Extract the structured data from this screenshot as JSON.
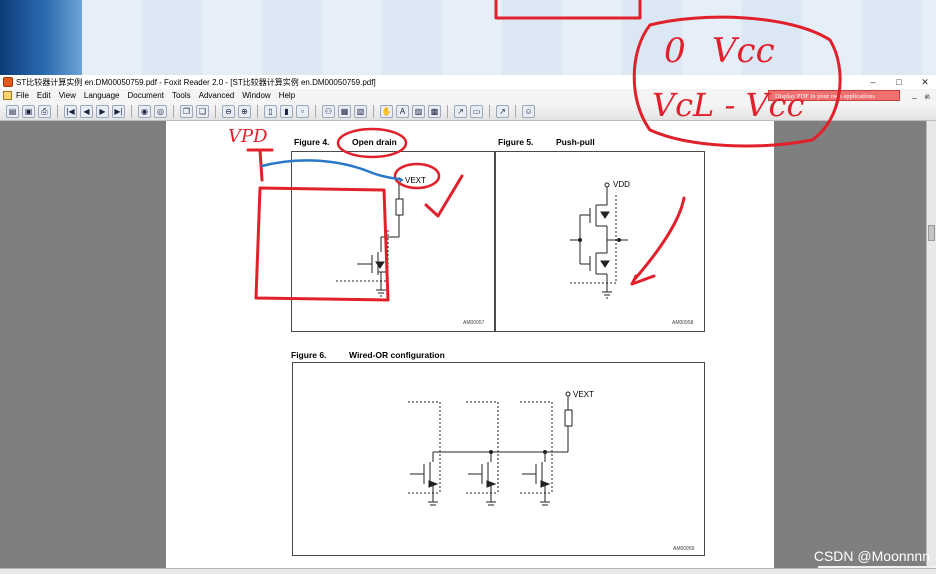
{
  "window": {
    "title": "ST比较器计算实例 en.DM00050759.pdf - Foxit Reader 2.0 - [ST比较器计算实例 en.DM00050759.pdf]",
    "minimize": "–",
    "maximize": "□",
    "close": "✕"
  },
  "menu": {
    "items": [
      "File",
      "Edit",
      "View",
      "Language",
      "Document",
      "Tools",
      "Advanced",
      "Window",
      "Help"
    ],
    "mdi_minimize": "_",
    "mdi_restore": "ต"
  },
  "ad_banner": "Display PDF in your own applications",
  "toolbar_icons": [
    "open-icon",
    "save-icon",
    "print-icon",
    "first-page-icon",
    "prev-page-icon",
    "next-page-icon",
    "last-page-icon",
    "go-back-icon",
    "go-forward-icon",
    "copy-icon",
    "paste-icon",
    "zoom-out-icon",
    "zoom-in-icon",
    "single-page-icon",
    "continuous-icon",
    "facing-icon",
    "find-icon",
    "thumbnail-icon",
    "bookmark-icon",
    "hand-tool-icon",
    "text-select-icon",
    "snapshot-icon",
    "image-icon",
    "select-icon",
    "annotate-icon",
    "arrow-icon",
    "plugin-icon"
  ],
  "figures": {
    "fig4": {
      "caption_num": "Figure 4.",
      "caption_text": "Open drain",
      "vext_label": "VEXT",
      "code": "AM00957"
    },
    "fig5": {
      "caption_num": "Figure 5.",
      "caption_text": "Push-pull",
      "vdd_label": "VDD",
      "code": "AM00958"
    },
    "fig6": {
      "caption_num": "Figure 6.",
      "caption_text": "Wired-OR configuration",
      "vext_label": "VEXT",
      "code": "AM00959"
    }
  },
  "handwriting": {
    "note_zero": "0",
    "note_vcc": "Vcc",
    "note_formula": "VcL - Vcc",
    "note_vpd": "VPD"
  },
  "watermark": "CSDN @Moonnnn",
  "colors": {
    "annotation_red": "#e0202a",
    "annotation_blue": "#2a78c8",
    "workspace_gray": "#7f7f7f"
  }
}
